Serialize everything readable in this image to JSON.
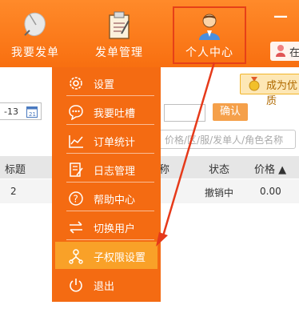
{
  "nav": {
    "items": [
      {
        "label": "我要发单",
        "icon": "mouse-icon"
      },
      {
        "label": "发单管理",
        "icon": "clipboard-icon"
      },
      {
        "label": "个人中心",
        "icon": "user-icon"
      }
    ],
    "minimize": "—",
    "user_label": "在"
  },
  "vip_button": "成为优质",
  "filters": {
    "date_value": "-13",
    "confirm_label": "确认",
    "search_placeholder": "价格/区/服/发单人/角色名称"
  },
  "table": {
    "headers": [
      "标题",
      "称",
      "状态",
      "价格 ▲"
    ],
    "rows": [
      {
        "title": "2",
        "status": "撤销中",
        "price": "0.00"
      }
    ]
  },
  "menu": {
    "items": [
      {
        "label": "设置",
        "icon": "gear-icon"
      },
      {
        "label": "我要吐槽",
        "icon": "chat-bubble-icon"
      },
      {
        "label": "订单统计",
        "icon": "line-chart-icon"
      },
      {
        "label": "日志管理",
        "icon": "edit-log-icon"
      },
      {
        "label": "帮助中心",
        "icon": "help-icon"
      },
      {
        "label": "切换用户",
        "icon": "swap-icon"
      },
      {
        "label": "子权限设置",
        "icon": "sub-permission-icon",
        "active": true
      },
      {
        "label": "退出",
        "icon": "power-icon"
      }
    ]
  },
  "colors": {
    "header_orange": "#f86f10",
    "menu_orange": "#f46b12",
    "active_item": "#f9a128",
    "highlight_red": "#e64018"
  }
}
